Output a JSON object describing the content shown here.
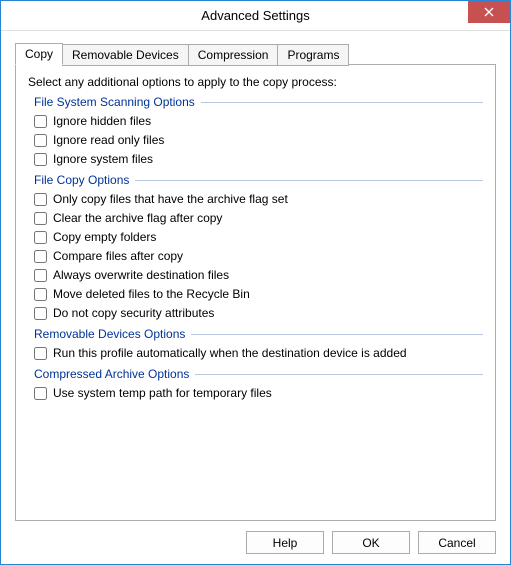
{
  "window": {
    "title": "Advanced Settings"
  },
  "tabs": {
    "copy": "Copy",
    "removable": "Removable Devices",
    "compression": "Compression",
    "programs": "Programs"
  },
  "intro": "Select any additional options to apply to the copy process:",
  "groups": {
    "fs": {
      "title": "File System Scanning Options",
      "ignore_hidden": "Ignore hidden files",
      "ignore_readonly": "Ignore read only files",
      "ignore_system": "Ignore system files"
    },
    "copy": {
      "title": "File Copy Options",
      "archive_flag": "Only copy files that have the archive flag set",
      "clear_archive": "Clear the archive flag after copy",
      "empty_folders": "Copy empty folders",
      "compare_after": "Compare files after copy",
      "overwrite_dest": "Always overwrite destination files",
      "recyclebin": "Move deleted files to the Recycle Bin",
      "no_security": "Do not copy security attributes"
    },
    "removable": {
      "title": "Removable Devices Options",
      "autorun": "Run this profile automatically when the destination device is added"
    },
    "compressed": {
      "title": "Compressed Archive Options",
      "temp_path": "Use system temp path for temporary files"
    }
  },
  "buttons": {
    "help": "Help",
    "ok": "OK",
    "cancel": "Cancel"
  }
}
